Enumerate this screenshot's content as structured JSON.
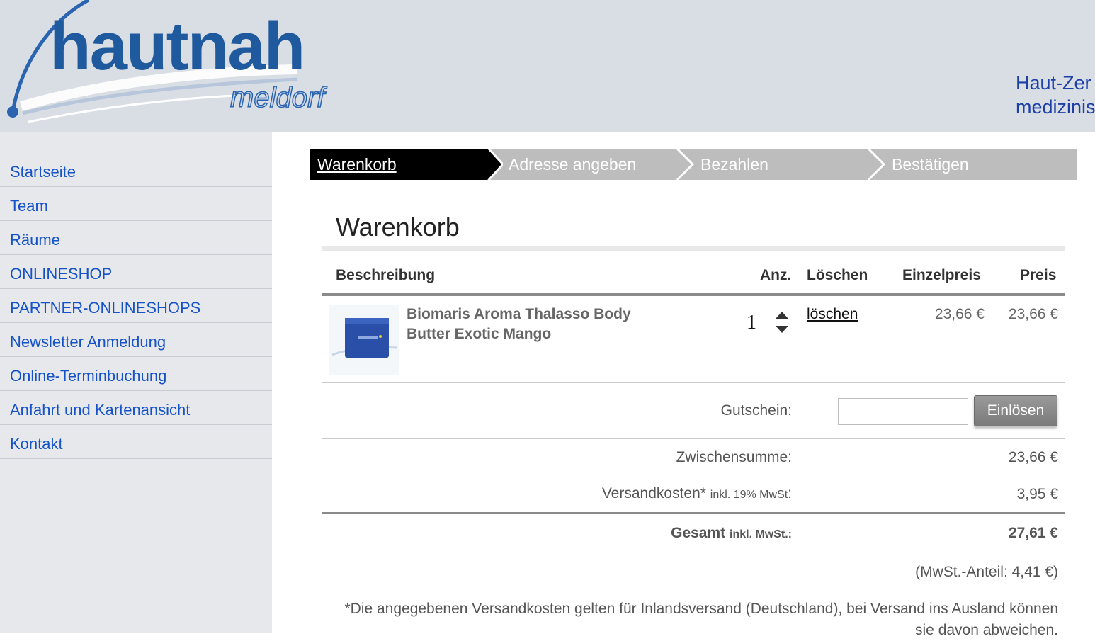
{
  "header": {
    "logo_main": "hautnah",
    "logo_sub": "meldorf",
    "tagline_line1": "Haut-Zer",
    "tagline_line2": "medizinis"
  },
  "sidebar": {
    "items": [
      {
        "label": "Startseite"
      },
      {
        "label": "Team"
      },
      {
        "label": "Räume"
      },
      {
        "label": "ONLINESHOP"
      },
      {
        "label": "PARTNER-ONLINESHOPS"
      },
      {
        "label": "Newsletter Anmeldung"
      },
      {
        "label": "Online-Terminbuchung"
      },
      {
        "label": "Anfahrt und Kartenansicht"
      },
      {
        "label": "Kontakt"
      }
    ]
  },
  "steps": [
    {
      "label": "Warenkorb",
      "active": true
    },
    {
      "label": "Adresse angeben",
      "active": false
    },
    {
      "label": "Bezahlen",
      "active": false
    },
    {
      "label": "Bestätigen",
      "active": false
    }
  ],
  "cart": {
    "title": "Warenkorb",
    "columns": {
      "description": "Beschreibung",
      "qty": "Anz.",
      "delete": "Löschen",
      "unit_price": "Einzelpreis",
      "price": "Preis"
    },
    "items": [
      {
        "name": "Biomaris Aroma Thalasso Body Butter Exotic Mango",
        "qty": "1",
        "delete_label": "löschen",
        "unit_price": "23,66 €",
        "price": "23,66 €"
      }
    ],
    "coupon_label": "Gutschein:",
    "coupon_value": "",
    "coupon_button": "Einlösen",
    "subtotal_label": "Zwischensumme:",
    "subtotal_value": "23,66 €",
    "shipping_label": "Versandkosten*",
    "shipping_note": "inkl. 19% MwSt",
    "shipping_colon": ":",
    "shipping_value": "3,95 €",
    "total_label": "Gesamt",
    "total_note": "inkl. MwSt.:",
    "total_value": "27,61 €",
    "vat_share": "(MwSt.-Anteil: 4,41 €)",
    "footnote": "*Die angegebenen Versandkosten gelten für Inlandsversand (Deutschland), bei Versand ins Ausland können sie davon abweichen."
  },
  "colors": {
    "header_bg": "#d9dee5",
    "sidebar_bg": "#e6e8ec",
    "link": "#1552c8",
    "logo": "#1f5a9e",
    "step_active": "#000000",
    "step_inactive": "#bdbdbd"
  }
}
